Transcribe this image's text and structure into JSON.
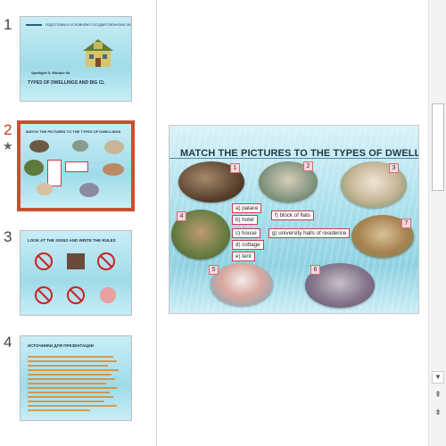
{
  "thumbnails": [
    {
      "number": "1",
      "title": "Spotlight D. Module 6b",
      "subtitle": "TYPES OF DWELLINGS AND BIG CL"
    },
    {
      "number": "2",
      "title": "MATCH THE PICTURES TO THE TYPES OF DWELLINGS",
      "selected": true,
      "has_animation": true
    },
    {
      "number": "3",
      "title": "LOOK AT THE SIGNS AND WRITE THE RULES"
    },
    {
      "number": "4",
      "title": "ИСТОЧНИКИ ДЛЯ ПРЕЗЕНТАЦИИ"
    }
  ],
  "animation_icon": "star-icon",
  "slide": {
    "title": "MATCH THE PICTURES TO THE TYPES OF DWELLINGS",
    "numbers": [
      "1",
      "2",
      "3",
      "4",
      "5",
      "6",
      "7"
    ],
    "options_left": [
      "a) palace",
      "b) hotel",
      "c) house",
      "d) cottage",
      "e) tent"
    ],
    "options_right": [
      "f) block of flats",
      "g) university halls of residence"
    ]
  },
  "scrollbar": {
    "up_icon": "▲",
    "down_icon": "▼",
    "prev_slide_icon": "⇞",
    "next_slide_icon": "⇟"
  },
  "colors": {
    "selected_outline": "#c8502e",
    "accent_number": "#c43e1c",
    "option_border": "#c83c4e"
  }
}
